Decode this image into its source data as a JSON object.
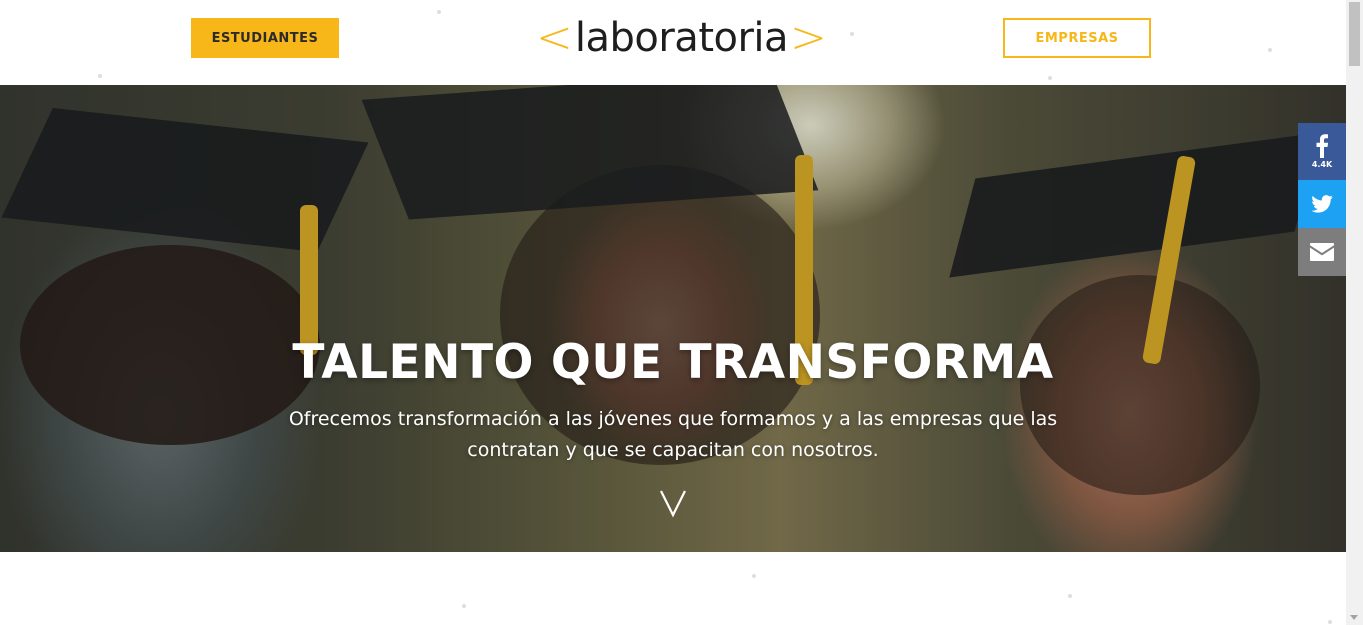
{
  "header": {
    "students_label": "ESTUDIANTES",
    "companies_label": "EMPRESAS",
    "logo": {
      "open": "<",
      "wordmark": "laboratoria",
      "close": ">"
    }
  },
  "hero": {
    "title": "TALENTO QUE TRANSFORMA",
    "subtitle": "Ofrecemos transformación a las jóvenes que formamos y a las empresas que las contratan y que se capacitan con nosotros.",
    "scroll_icon": "chevron-down-icon"
  },
  "social": {
    "facebook_count": "4.4K",
    "icons": [
      "facebook-icon",
      "twitter-icon",
      "email-icon"
    ]
  },
  "colors": {
    "brand_yellow": "#f7b718",
    "facebook": "#3a5998",
    "twitter": "#1da1f2",
    "email": "#7d7d7d"
  }
}
